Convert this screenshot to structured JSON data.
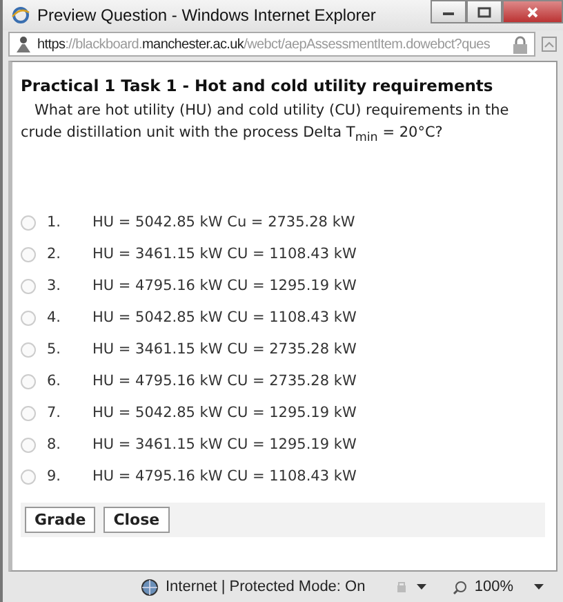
{
  "window": {
    "title": "Preview Question - Windows Internet Explorer"
  },
  "address_bar": {
    "segments": [
      {
        "text": "https",
        "kind": "normal"
      },
      {
        "text": "://blackboard.",
        "kind": "dim"
      },
      {
        "text": "manchester.ac.uk",
        "kind": "normal"
      },
      {
        "text": "/webct/aepAssessmentItem.dowebct?ques",
        "kind": "dim"
      }
    ]
  },
  "question": {
    "title": "Practical 1 Task 1 - Hot and cold utility requirements",
    "text": "What are hot utility (HU) and cold utility (CU) requirements in the crude distillation unit with the process Delta T$_{min}$ = 20°C?"
  },
  "options": [
    {
      "number": "1.",
      "text": "HU = 5042.85 kW Cu = 2735.28 kW",
      "selected": false
    },
    {
      "number": "2.",
      "text": "HU = 3461.15 kW CU = 1108.43 kW",
      "selected": false
    },
    {
      "number": "3.",
      "text": "HU = 4795.16 kW CU = 1295.19 kW",
      "selected": false
    },
    {
      "number": "4.",
      "text": "HU = 5042.85 kW CU = 1108.43 kW",
      "selected": false
    },
    {
      "number": "5.",
      "text": "HU = 3461.15 kW CU = 2735.28 kW",
      "selected": false
    },
    {
      "number": "6.",
      "text": "HU = 4795.16 kW CU = 2735.28 kW",
      "selected": false
    },
    {
      "number": "7.",
      "text": "HU = 5042.85 kW CU = 1295.19 kW",
      "selected": false
    },
    {
      "number": "8.",
      "text": "HU = 3461.15 kW CU = 1295.19 kW",
      "selected": false
    },
    {
      "number": "9.",
      "text": "HU = 4795.16 kW CU = 1108.43 kW",
      "selected": false
    }
  ],
  "buttons": [
    "Grade",
    "Close"
  ],
  "status_bar": {
    "zone": "Internet | Protected Mode: On",
    "zoom": "100%"
  }
}
